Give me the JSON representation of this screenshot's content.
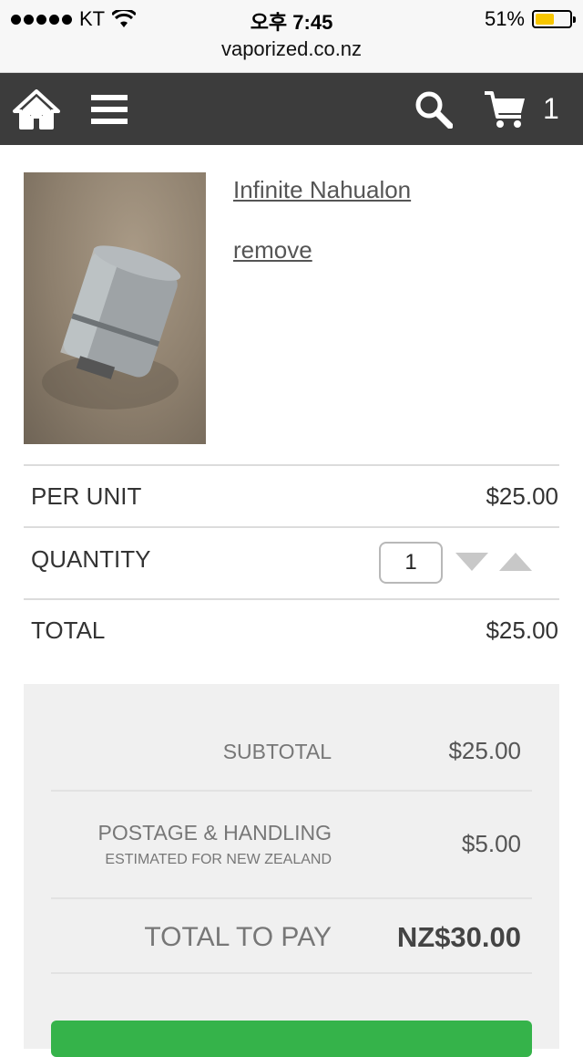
{
  "status_bar": {
    "carrier": "KT",
    "time": "오후 7:45",
    "battery_percent": "51%",
    "battery_level": 0.51,
    "battery_color": "#f7c600"
  },
  "browser": {
    "url": "vaporized.co.nz"
  },
  "nav": {
    "icons": [
      "home-icon",
      "menu-icon",
      "search-icon",
      "cart-icon"
    ],
    "cart_count": "1",
    "background": "#3c3c3c"
  },
  "product": {
    "name": "Infinite Nahualon",
    "remove_label": "remove",
    "image_icon": "product-photo"
  },
  "rows": {
    "per_unit_label": "PER UNIT",
    "per_unit_value": "$25.00",
    "quantity_label": "QUANTITY",
    "quantity_value": "1",
    "total_label": "TOTAL",
    "total_value": "$25.00"
  },
  "summary": {
    "subtotal_label": "SUBTOTAL",
    "subtotal_value": "$25.00",
    "postage_label": "POSTAGE & HANDLING",
    "postage_sublabel": "ESTIMATED FOR NEW ZEALAND",
    "postage_value": "$5.00",
    "total_pay_label": "TOTAL TO PAY",
    "total_pay_value": "NZ$30.00"
  },
  "colors": {
    "accent_green": "#35b34a",
    "panel_bg": "#f0f0f0"
  }
}
